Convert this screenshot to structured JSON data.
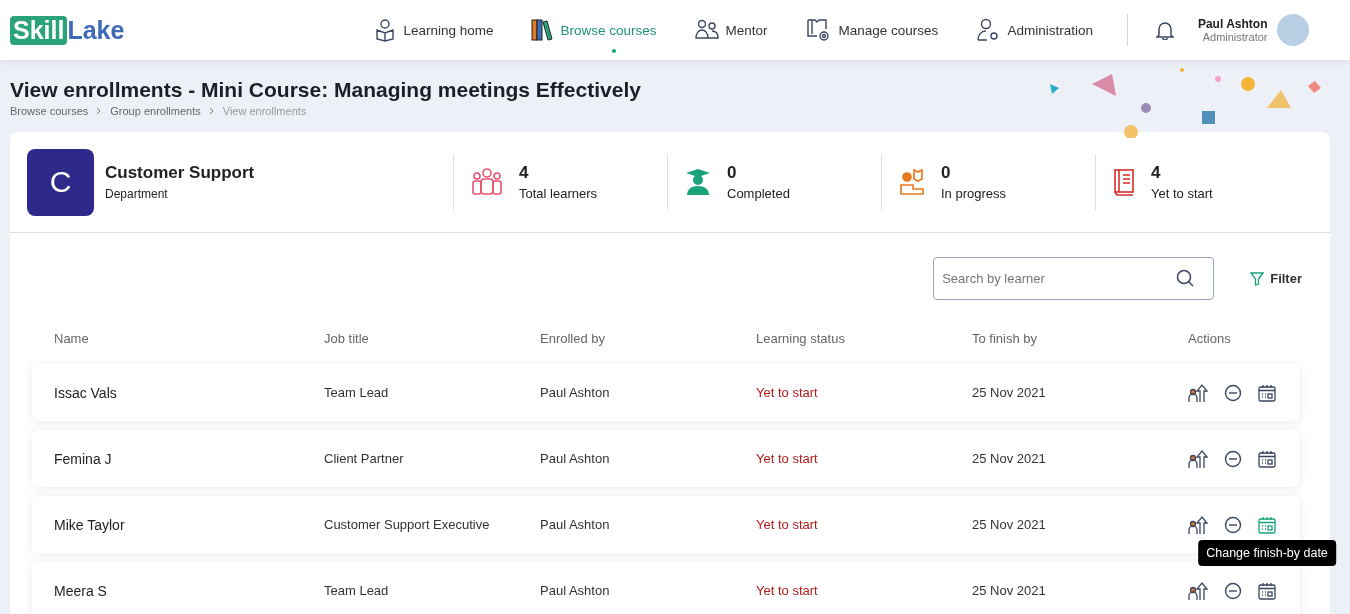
{
  "logo": {
    "part_1": "Skill",
    "part_2": "Lake"
  },
  "nav": [
    {
      "label": "Learning home",
      "kind": "reader",
      "selected": false
    },
    {
      "label": "Browse courses",
      "kind": "books",
      "selected": true
    },
    {
      "label": "Mentor",
      "kind": "mentor",
      "selected": false
    },
    {
      "label": "Manage courses",
      "kind": "manage",
      "selected": false
    },
    {
      "label": "Administration",
      "kind": "admin",
      "selected": false
    }
  ],
  "user": {
    "name": "Paul Ashton",
    "role": "Administrator"
  },
  "page_title": "View enrollments - Mini Course: Managing meetings Effectively",
  "breadcrumb": [
    "Browse courses",
    "Group enrollments",
    "View enrollments"
  ],
  "group": {
    "initial": "C",
    "name": "Customer Support",
    "type": "Department"
  },
  "stats": [
    {
      "kind": "learners",
      "value": "4",
      "label": "Total learners"
    },
    {
      "kind": "completed",
      "value": "0",
      "label": "Completed"
    },
    {
      "kind": "in_progress",
      "value": "0",
      "label": "In progress"
    },
    {
      "kind": "yet_to_start",
      "value": "4",
      "label": "Yet to start"
    }
  ],
  "search": {
    "placeholder": "Search by learner"
  },
  "filter_label": "Filter",
  "table": {
    "columns": [
      "Name",
      "Job title",
      "Enrolled by",
      "Learning status",
      "To finish by",
      "Actions"
    ],
    "rows": [
      {
        "name": "Issac Vals",
        "job_title": "Team Lead",
        "enrolled_by": "Paul Ashton",
        "status": "Yet to start",
        "finish_by": "25 Nov 2021",
        "date_action_hovered": false
      },
      {
        "name": "Femina J",
        "job_title": "Client Partner",
        "enrolled_by": "Paul Ashton",
        "status": "Yet to start",
        "finish_by": "25 Nov 2021",
        "date_action_hovered": false
      },
      {
        "name": "Mike Taylor",
        "job_title": "Customer Support Executive",
        "enrolled_by": "Paul Ashton",
        "status": "Yet to start",
        "finish_by": "25 Nov 2021",
        "date_action_hovered": true
      },
      {
        "name": "Meera S",
        "job_title": "Team Lead",
        "enrolled_by": "Paul Ashton",
        "status": "Yet to start",
        "finish_by": "25 Nov 2021",
        "date_action_hovered": false
      }
    ]
  },
  "tooltip": "Change finish-by date"
}
